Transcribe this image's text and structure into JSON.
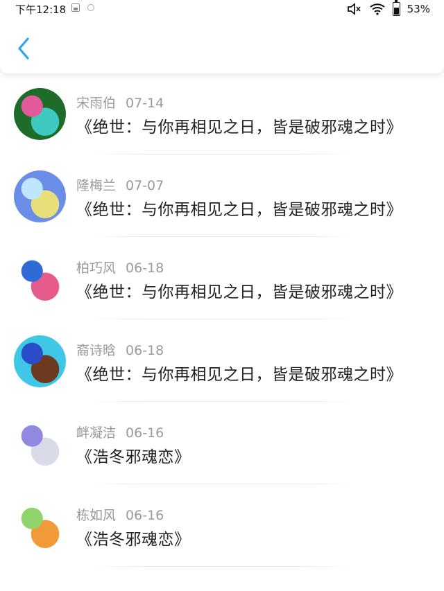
{
  "status_bar": {
    "time": "下午12:18",
    "battery": "53%",
    "battery_level": 0.53
  },
  "comments": [
    {
      "name": "",
      "date": "",
      "title": "《绝世：与你再相见之日，皆是破邪魂之时》",
      "avatar_colors": [
        "#5a3a1c",
        "#c98a3a"
      ]
    },
    {
      "name": "宋雨伯",
      "date": "07-14",
      "title": "《绝世：与你再相见之日，皆是破邪魂之时》",
      "avatar_colors": [
        "#1f6b2a",
        "#3ec9c0",
        "#e25a9a"
      ]
    },
    {
      "name": "隆梅兰",
      "date": "07-07",
      "title": "《绝世：与你再相见之日，皆是破邪魂之时》",
      "avatar_colors": [
        "#6a8de8",
        "#e7e07a",
        "#bfe6ff"
      ]
    },
    {
      "name": "柏巧风",
      "date": "06-18",
      "title": "《绝世：与你再相见之日，皆是破邪魂之时》",
      "avatar_colors": [
        "#ffffff",
        "#e55b8c",
        "#2f6bd6"
      ]
    },
    {
      "name": "裔诗晗",
      "date": "06-18",
      "title": "《绝世：与你再相见之日，皆是破邪魂之时》",
      "avatar_colors": [
        "#3fc7e6",
        "#6b3a20",
        "#2a4cc9"
      ]
    },
    {
      "name": "衅凝洁",
      "date": "06-16",
      "title": "《浩冬邪魂恋》",
      "avatar_colors": [
        "#ffffff",
        "#d9dbe8",
        "#8f8ae0"
      ]
    },
    {
      "name": "栋如风",
      "date": "06-16",
      "title": "《浩冬邪魂恋》",
      "avatar_colors": [
        "#ffffff",
        "#f29a3a",
        "#8fd36a"
      ]
    }
  ]
}
